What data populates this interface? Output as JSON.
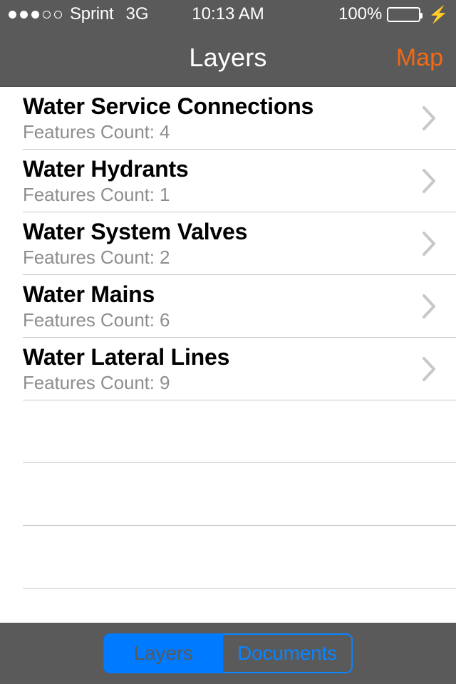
{
  "status_bar": {
    "signal_dots_filled": 3,
    "signal_dots_total": 5,
    "carrier": "Sprint",
    "network": "3G",
    "time": "10:13 AM",
    "battery_percent": "100%",
    "battery_color": "#4cd964",
    "charging": true
  },
  "nav_bar": {
    "title": "Layers",
    "right_button_label": "Map",
    "right_button_color": "#f26a12",
    "background_color": "#5a5a5a"
  },
  "layers": [
    {
      "title": "Water Service Connections",
      "subtitle": "Features Count: 4"
    },
    {
      "title": "Water Hydrants",
      "subtitle": "Features Count: 1"
    },
    {
      "title": "Water System Valves",
      "subtitle": "Features Count: 2"
    },
    {
      "title": "Water Mains",
      "subtitle": "Features Count: 6"
    },
    {
      "title": "Water Lateral Lines",
      "subtitle": "Features Count: 9"
    }
  ],
  "empty_rows": 3,
  "toolbar": {
    "segments": [
      {
        "label": "Layers",
        "selected": true
      },
      {
        "label": "Documents",
        "selected": false
      }
    ],
    "accent_color": "#007aff",
    "background_color": "#5a5a5a"
  }
}
